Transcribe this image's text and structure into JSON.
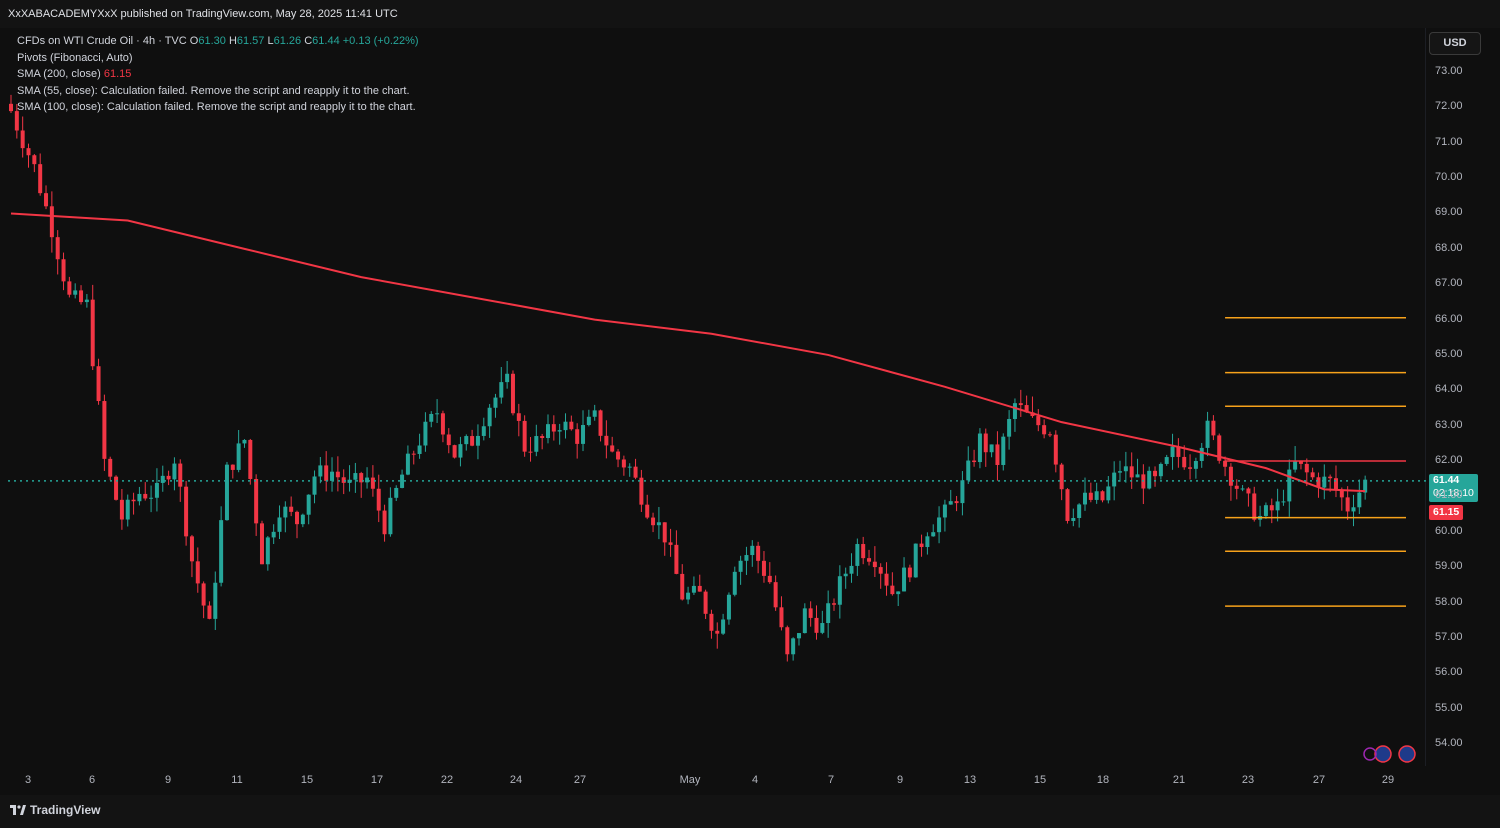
{
  "header": {
    "published_text": "XxXABACADEMYXxX published on TradingView.com, May 28, 2025 11:41 UTC"
  },
  "legend": {
    "symbol": "CFDs on WTI Crude Oil · 4h · TVC",
    "o_label": "O",
    "o_value": "61.30",
    "h_label": "H",
    "h_value": "61.57",
    "l_label": "L",
    "l_value": "61.26",
    "c_label": "C",
    "c_value": "61.44",
    "change": "+0.13 (+0.22%)",
    "pivots": "Pivots (Fibonacci, Auto)",
    "sma200_label": "SMA (200, close)",
    "sma200_value": "61.15",
    "sma55_text": "SMA (55, close): Calculation failed. Remove the script and reapply it to the chart.",
    "sma100_text": "SMA (100, close): Calculation failed. Remove the script and reapply it to the chart."
  },
  "price_scale": {
    "currency": "USD",
    "last_price": "61.44",
    "countdown": "02:18:10",
    "sma_price": "61.15"
  },
  "footer": {
    "brand": "TradingView"
  },
  "colors": {
    "up": "#26a69a",
    "down": "#f23645",
    "sma": "#f23645",
    "pivot": "#f7a21b",
    "pivot_top": "#f23645",
    "background": "#0f0f0f"
  },
  "chart_data": {
    "type": "candlestick",
    "title": "CFDs on WTI Crude Oil · 4h · TVC",
    "ylim": [
      53.6,
      73.6
    ],
    "y_ticks": [
      "73.00",
      "72.00",
      "71.00",
      "70.00",
      "69.00",
      "68.00",
      "67.00",
      "66.00",
      "65.00",
      "64.00",
      "63.00",
      "62.00",
      "61.00",
      "60.00",
      "59.00",
      "58.00",
      "57.00",
      "56.00",
      "55.00",
      "54.00"
    ],
    "x_ticks": [
      "3",
      "6",
      "9",
      "11",
      "15",
      "17",
      "22",
      "24",
      "27",
      "May",
      "4",
      "7",
      "9",
      "13",
      "15",
      "18",
      "21",
      "23",
      "27",
      "29"
    ],
    "last_price": 61.44,
    "close_path": [
      [
        0,
        71.9
      ],
      [
        4,
        70.3
      ],
      [
        7,
        68.6
      ],
      [
        10,
        66.6
      ],
      [
        13,
        66.4
      ],
      [
        16,
        62.0
      ],
      [
        19,
        60.4
      ],
      [
        22,
        61.1
      ],
      [
        25,
        61.1
      ],
      [
        28,
        62.1
      ],
      [
        31,
        59.2
      ],
      [
        34,
        57.3
      ],
      [
        37,
        61.7
      ],
      [
        40,
        62.6
      ],
      [
        43,
        59.3
      ],
      [
        46,
        60.7
      ],
      [
        49,
        60.3
      ],
      [
        52,
        61.6
      ],
      [
        55,
        61.7
      ],
      [
        58,
        61.3
      ],
      [
        61,
        61.5
      ],
      [
        64,
        60.2
      ],
      [
        67,
        61.6
      ],
      [
        70,
        62.6
      ],
      [
        73,
        63.4
      ],
      [
        76,
        62.2
      ],
      [
        79,
        62.6
      ],
      [
        82,
        63.6
      ],
      [
        85,
        64.2
      ],
      [
        88,
        62.4
      ],
      [
        91,
        62.6
      ],
      [
        94,
        63.1
      ],
      [
        97,
        62.7
      ],
      [
        100,
        63.2
      ],
      [
        103,
        62.2
      ],
      [
        106,
        61.8
      ],
      [
        109,
        60.7
      ],
      [
        112,
        59.9
      ],
      [
        115,
        58.2
      ],
      [
        118,
        58.2
      ],
      [
        121,
        57.1
      ],
      [
        124,
        59.1
      ],
      [
        127,
        59.5
      ],
      [
        130,
        58.6
      ],
      [
        133,
        56.4
      ],
      [
        136,
        57.7
      ],
      [
        139,
        57.3
      ],
      [
        142,
        58.5
      ],
      [
        145,
        59.6
      ],
      [
        148,
        59.3
      ],
      [
        151,
        58.3
      ],
      [
        154,
        59.0
      ],
      [
        157,
        60.1
      ],
      [
        160,
        60.5
      ],
      [
        163,
        61.3
      ],
      [
        166,
        62.6
      ],
      [
        169,
        62.0
      ],
      [
        172,
        63.6
      ],
      [
        175,
        63.1
      ],
      [
        178,
        62.9
      ],
      [
        181,
        60.5
      ],
      [
        184,
        60.9
      ],
      [
        187,
        60.9
      ],
      [
        190,
        61.8
      ],
      [
        193,
        61.5
      ],
      [
        196,
        61.4
      ],
      [
        199,
        62.2
      ],
      [
        202,
        62.0
      ],
      [
        205,
        62.9
      ],
      [
        208,
        61.9
      ],
      [
        211,
        61.0
      ],
      [
        214,
        60.4
      ],
      [
        217,
        60.7
      ],
      [
        220,
        61.9
      ],
      [
        223,
        61.5
      ],
      [
        226,
        61.4
      ],
      [
        229,
        60.7
      ],
      [
        232,
        61.4
      ]
    ],
    "sma_200": [
      [
        0,
        69.0
      ],
      [
        20,
        68.8
      ],
      [
        40,
        68.0
      ],
      [
        60,
        67.2
      ],
      [
        80,
        66.6
      ],
      [
        100,
        66.0
      ],
      [
        120,
        65.6
      ],
      [
        140,
        65.0
      ],
      [
        160,
        64.1
      ],
      [
        180,
        63.1
      ],
      [
        200,
        62.4
      ],
      [
        215,
        61.8
      ],
      [
        225,
        61.2
      ],
      [
        232,
        61.15
      ]
    ],
    "pivot_levels": [
      66.05,
      64.5,
      63.55,
      62.0,
      60.4,
      59.45,
      57.9
    ],
    "pivot_start_x": 208
  }
}
